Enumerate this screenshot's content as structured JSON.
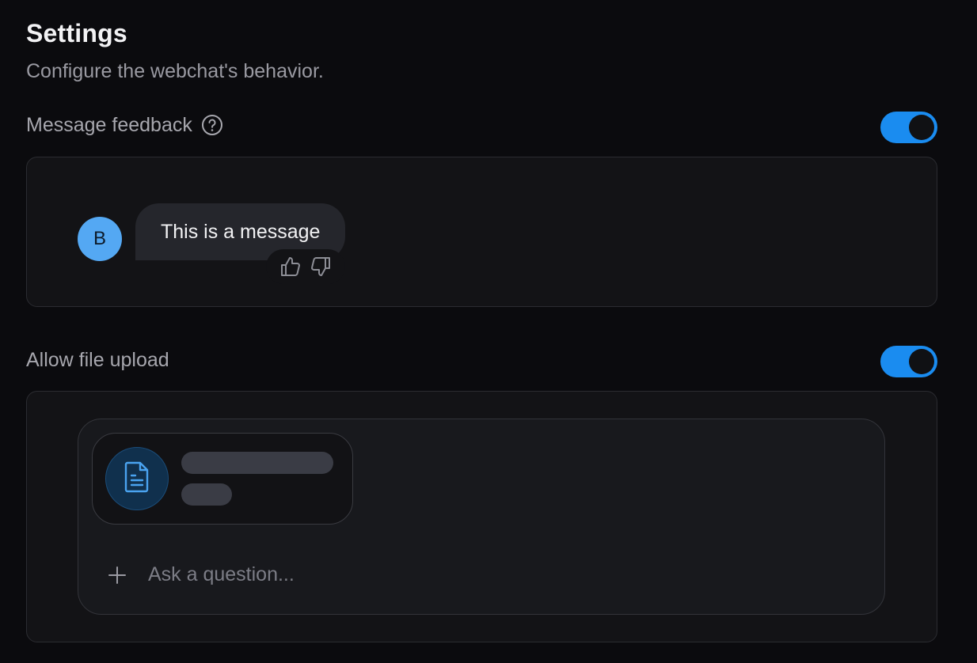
{
  "header": {
    "title": "Settings",
    "subtitle": "Configure the webchat's behavior."
  },
  "message_feedback": {
    "label": "Message feedback",
    "help_icon": "question-circle-icon",
    "enabled": true,
    "preview": {
      "avatar_initial": "B",
      "message_text": "This is a message",
      "icons": [
        "thumbs-up-icon",
        "thumbs-down-icon"
      ]
    }
  },
  "file_upload": {
    "label": "Allow file upload",
    "enabled": true,
    "preview": {
      "file_icon": "document-icon",
      "add_icon": "plus-icon",
      "input_placeholder": "Ask a question..."
    }
  },
  "colors": {
    "background": "#0b0b0e",
    "accent": "#1a8cf0",
    "avatar": "#54a8f3"
  }
}
